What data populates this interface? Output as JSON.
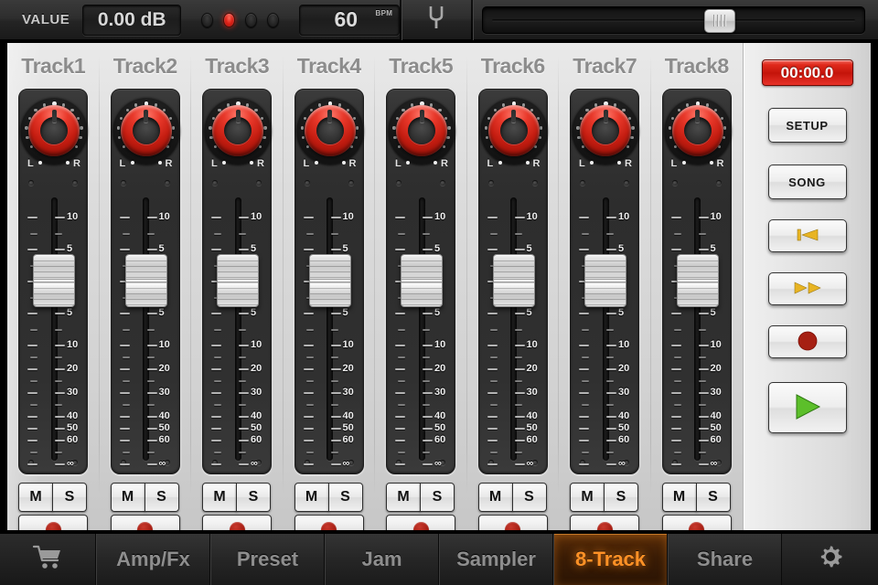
{
  "topbar": {
    "value_label": "VALUE",
    "value_display": "0.00 dB",
    "bpm_value": "60",
    "bpm_unit": "BPM",
    "leds": [
      {
        "name": "metronome-led-1",
        "on": false
      },
      {
        "name": "metronome-led-2",
        "on": true
      },
      {
        "name": "metronome-led-3",
        "on": false
      },
      {
        "name": "metronome-led-4",
        "on": false
      }
    ],
    "tuner_icon": "tuning-fork-icon",
    "slider": {
      "name": "master-slider",
      "position_percent": 62
    }
  },
  "tracks": [
    {
      "name": "Track1",
      "pan": 0,
      "fader_db": 0,
      "mute_label": "M",
      "solo_label": "S",
      "armed": true
    },
    {
      "name": "Track2",
      "pan": 0,
      "fader_db": 0,
      "mute_label": "M",
      "solo_label": "S",
      "armed": true
    },
    {
      "name": "Track3",
      "pan": 0,
      "fader_db": 0,
      "mute_label": "M",
      "solo_label": "S",
      "armed": true
    },
    {
      "name": "Track4",
      "pan": 0,
      "fader_db": 0,
      "mute_label": "M",
      "solo_label": "S",
      "armed": true
    },
    {
      "name": "Track5",
      "pan": 0,
      "fader_db": 0,
      "mute_label": "M",
      "solo_label": "S",
      "armed": true
    },
    {
      "name": "Track6",
      "pan": 0,
      "fader_db": 0,
      "mute_label": "M",
      "solo_label": "S",
      "armed": true
    },
    {
      "name": "Track7",
      "pan": 0,
      "fader_db": 0,
      "mute_label": "M",
      "solo_label": "S",
      "armed": true
    },
    {
      "name": "Track8",
      "pan": 0,
      "fader_db": 0,
      "mute_label": "M",
      "solo_label": "S",
      "armed": true
    }
  ],
  "pan": {
    "left_label": "L",
    "right_label": "R"
  },
  "fader_scale": [
    "10",
    "5",
    "0",
    "5",
    "10",
    "20",
    "30",
    "40",
    "50",
    "60",
    "∞"
  ],
  "sidebar": {
    "timer": "00:00.0",
    "setup_label": "SETUP",
    "song_label": "SONG",
    "rewind_icon": "rewind-to-start-icon",
    "forward_icon": "fast-forward-icon",
    "record_icon": "record-icon",
    "play_icon": "play-icon"
  },
  "tabbar": {
    "cart_icon": "shopping-cart-icon",
    "gear_icon": "gear-icon",
    "tabs": [
      {
        "label": "Amp/Fx",
        "active": false
      },
      {
        "label": "Preset",
        "active": false
      },
      {
        "label": "Jam",
        "active": false
      },
      {
        "label": "Sampler",
        "active": false
      },
      {
        "label": "8-Track",
        "active": true
      },
      {
        "label": "Share",
        "active": false
      }
    ]
  },
  "colors": {
    "accent_orange": "#ff9126",
    "knob_red": "#e8382a",
    "timer_red": "#c4140a",
    "play_green": "#5cbf2a",
    "transport_yellow": "#e8b423"
  }
}
